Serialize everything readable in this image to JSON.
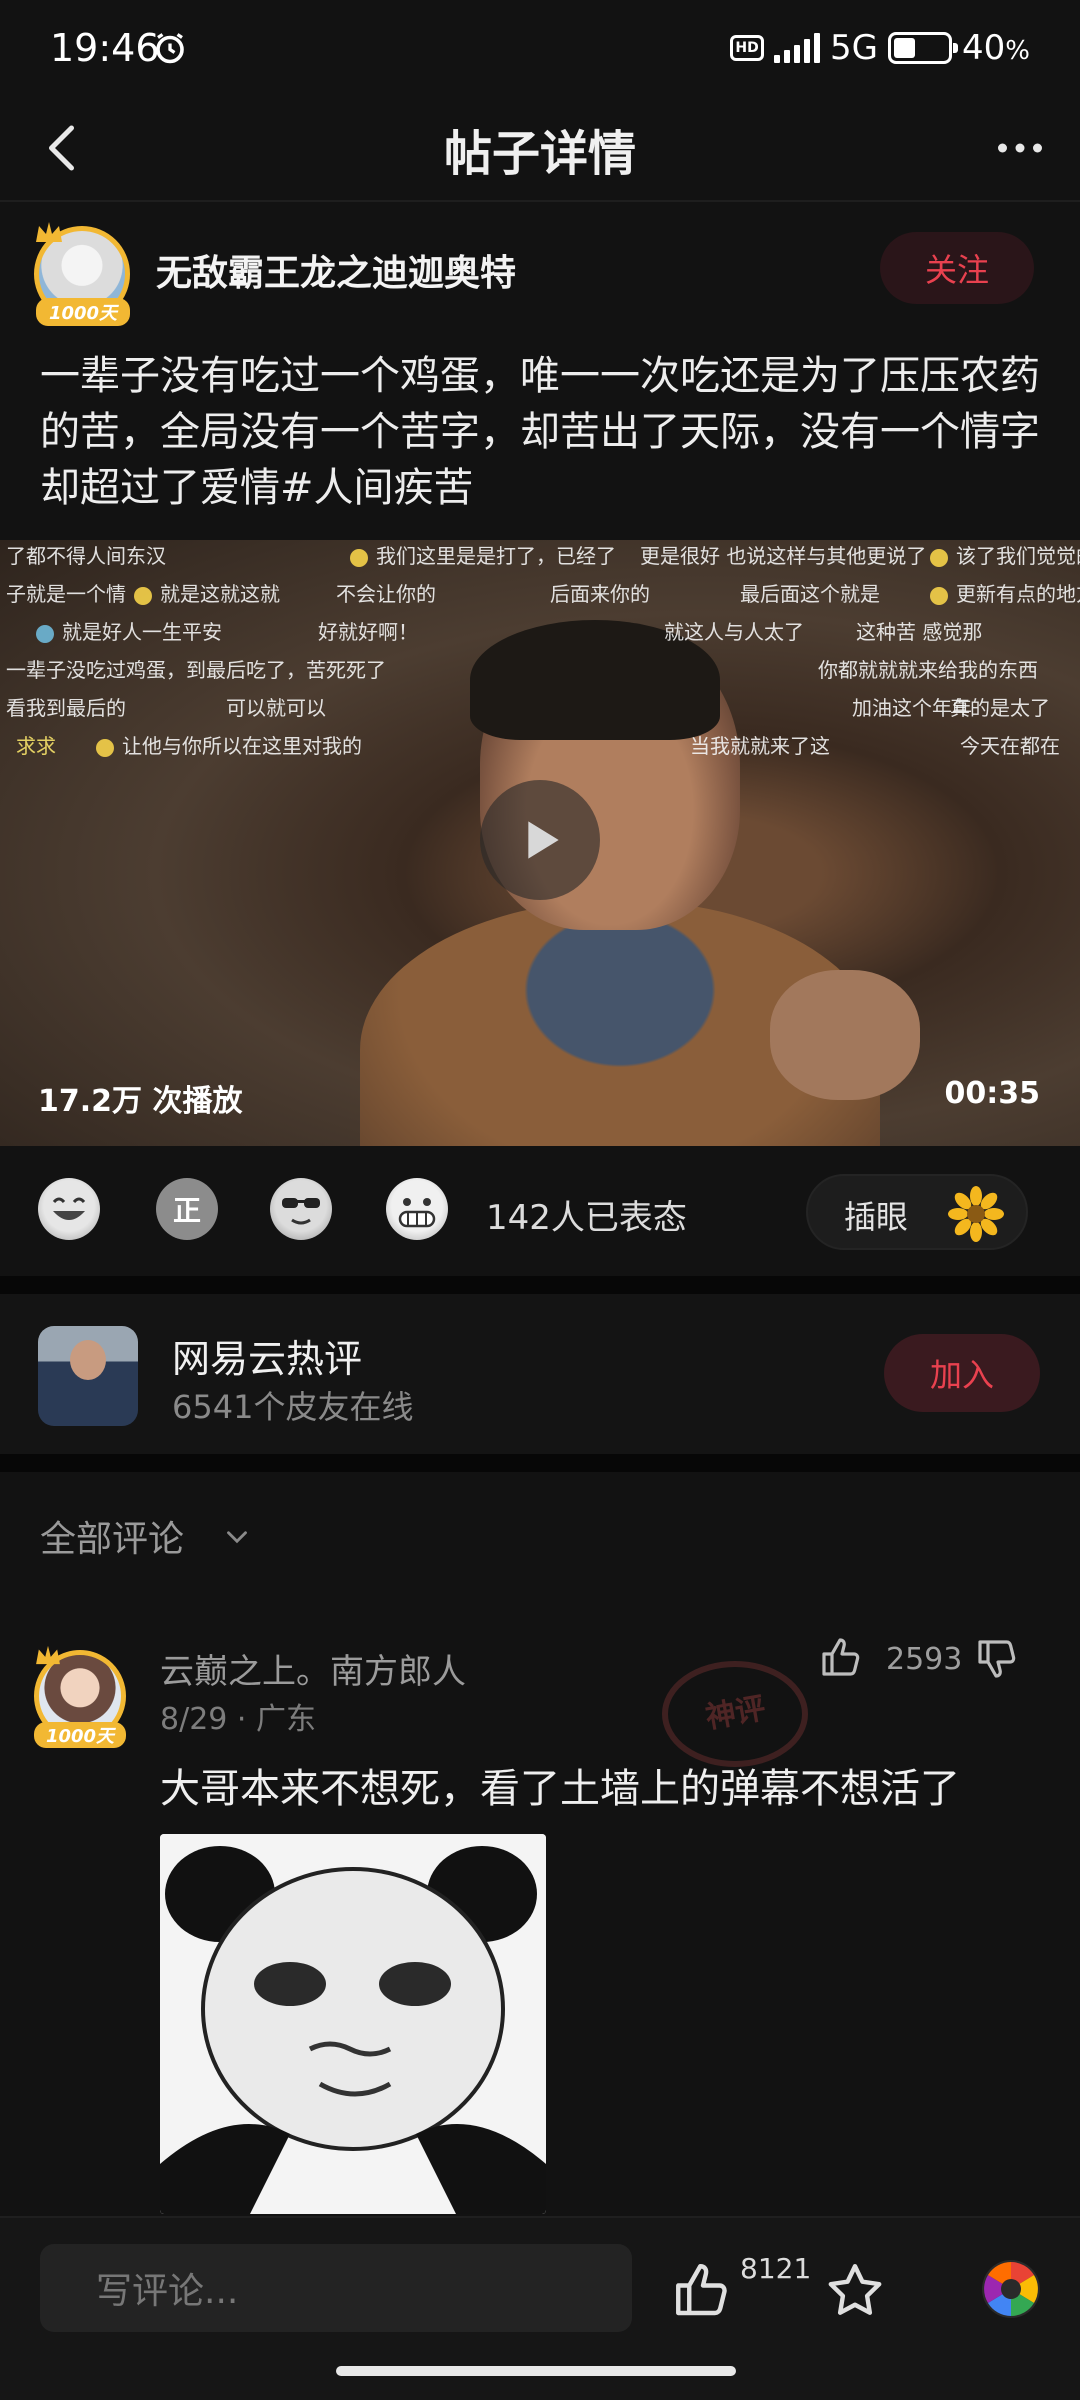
{
  "status_bar": {
    "time": "19:46",
    "network": "5G",
    "battery_percent": "40",
    "battery_sign": "%",
    "battery_level": 0.4
  },
  "nav": {
    "title": "帖子详情"
  },
  "post": {
    "author": "无敌霸王龙之迪迦奥特",
    "author_badge": "1000天",
    "follow_label": "关注",
    "text": "一辈子没有吃过一个鸡蛋，唯一一次吃还是为了压压农药的苦，全局没有一个苦字，却苦出了天际，没有一个情字却超过了爱情#人间疾苦",
    "video": {
      "play_count": "17.2万 次播放",
      "duration": "00:35",
      "danmaku": [
        "了都不得人间东汉",
        "我们这里是是打了，已经了",
        "更是很好  也说这样与其他更说了",
        "该了我们觉觉的了",
        "子就是一个情",
        "就是这就这就",
        "不会让你的",
        "后面来你的",
        "最后面这个就是",
        "更新有点的地方",
        "就是好人一生平安",
        "好就好啊！",
        "就这人与人太了",
        "这种苦 感觉那",
        "一辈子没吃过鸡蛋，到最后吃了，苦死死了",
        "你都就就就来给我的东西",
        "看我到最后的",
        "可以就可以",
        "加油这个年年",
        "当我就就来了这",
        "真的是太了",
        "求求",
        "让他与你所以在这里对我的",
        "今天在都在"
      ]
    },
    "reactions": {
      "emoji": [
        "laugh-emoji",
        "zheng-emoji",
        "cool-emoji",
        "grin-emoji"
      ],
      "zheng_char": "正",
      "count_text": "142人已表态",
      "chayan_label": "插眼"
    }
  },
  "group": {
    "name": "网易云热评",
    "online": "6541个皮友在线",
    "join_label": "加入"
  },
  "comments": {
    "header": "全部评论",
    "items": [
      {
        "user": "云巅之上。南方郎人",
        "badge": "1000天",
        "meta": "8/29 · 广东",
        "likes": "2593",
        "stamp": "神评",
        "text": "大哥本来不想死，看了土墙上的弹幕不想活了"
      }
    ]
  },
  "bottom_bar": {
    "placeholder": "写评论...",
    "like_count": "8121"
  },
  "colors": {
    "accent": "#e9414f",
    "badge_gold": "#f2b833",
    "background": "#121212"
  }
}
